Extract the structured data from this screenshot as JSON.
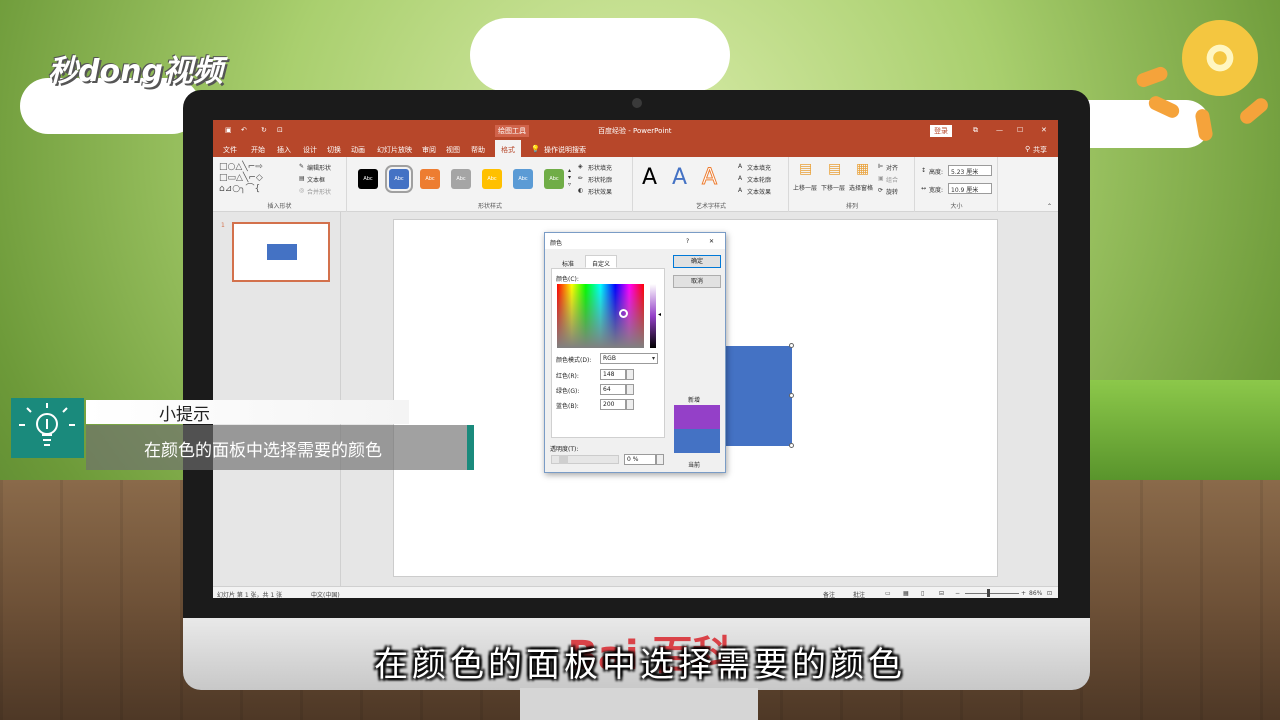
{
  "watermark": {
    "logo_text": "秒dong视频",
    "baidu_text": "Bai 百科"
  },
  "titlebar": {
    "tool_context": "绘图工具",
    "doc_title": "百度经验 - PowerPoint",
    "login": "登录"
  },
  "menu": {
    "items": [
      "文件",
      "开始",
      "插入",
      "设计",
      "切换",
      "动画",
      "幻灯片放映",
      "审阅",
      "视图",
      "帮助",
      "格式"
    ],
    "tell_me": "操作说明搜索",
    "share": "共享"
  },
  "ribbon": {
    "insert_shapes": {
      "label": "插入形状",
      "edit_shape": "编辑形状",
      "text_box": "文本框",
      "merge_shapes": "合并形状"
    },
    "shape_styles": {
      "label": "形状样式",
      "swatch_text": "Abc",
      "swatch_colors": [
        "#000000",
        "#4472c4",
        "#ed7d31",
        "#a5a5a5",
        "#ffc000",
        "#5b9bd5",
        "#70ad47"
      ],
      "fill": "形状填充",
      "outline": "形状轮廓",
      "effects": "形状效果"
    },
    "wordart": {
      "label": "艺术字样式",
      "letter": "A",
      "text_fill": "文本填充",
      "text_outline": "文本轮廓",
      "text_effects": "文本效果"
    },
    "arrange": {
      "label": "排列",
      "bring_forward": "上移一层",
      "send_backward": "下移一层",
      "selection_pane": "选择窗格",
      "align": "对齐",
      "group": "组合",
      "rotate": "旋转"
    },
    "size": {
      "label": "大小",
      "height_label": "高度:",
      "height": "5.23 厘米",
      "width_label": "宽度:",
      "width": "10.9 厘米"
    }
  },
  "thumbnail": {
    "number": "1"
  },
  "statusbar": {
    "slide_info": "幻灯片 第 1 张，共 1 张",
    "language": "中文(中国)",
    "notes": "备注",
    "comments": "批注",
    "zoom": "86%"
  },
  "dialog": {
    "title": "颜色",
    "help": "?",
    "close": "✕",
    "tabs": [
      "标准",
      "自定义"
    ],
    "colors_label": "颜色(C):",
    "mode_label": "颜色模式(D):",
    "mode_value": "RGB",
    "red_label": "红色(R):",
    "red": "148",
    "green_label": "绿色(G):",
    "green": "64",
    "blue_label": "蓝色(B):",
    "blue": "200",
    "ok": "确定",
    "cancel": "取消",
    "new_label": "新增",
    "current_label": "当前",
    "transparency_label": "透明度(T):",
    "transparency": "0 %",
    "new_color": "#9440c8",
    "current_color": "#4472c4"
  },
  "tip": {
    "title": "小提示",
    "body": "在颜色的面板中选择需要的颜色"
  },
  "subtitle": "在颜色的面板中选择需要的颜色"
}
